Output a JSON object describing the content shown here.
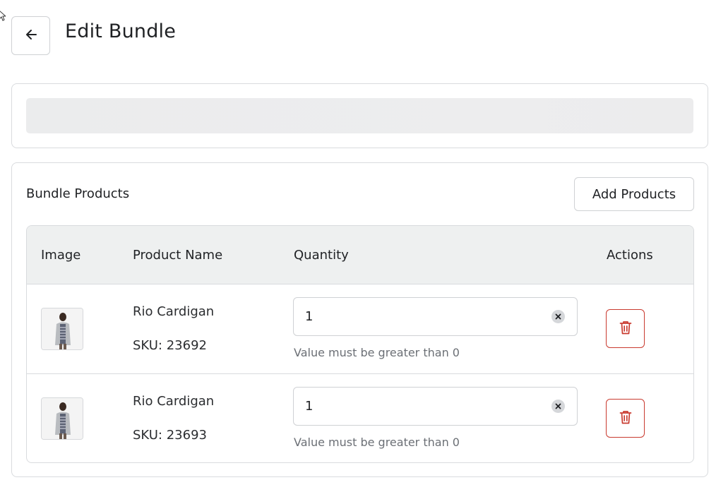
{
  "header": {
    "back_icon": "arrow-left-icon",
    "title": "Edit Bundle"
  },
  "bundle_products": {
    "title": "Bundle Products",
    "add_button_label": "Add Products",
    "columns": [
      "Image",
      "Product Name",
      "Quantity",
      "Actions"
    ],
    "rows": [
      {
        "image_icon": "product-thumbnail",
        "name": "Rio Cardigan",
        "sku": "SKU: 23692",
        "quantity": "1",
        "helper_text": "Value must be greater than 0",
        "clear_icon": "clear-x-icon",
        "delete_icon": "trash-icon"
      },
      {
        "image_icon": "product-thumbnail",
        "name": "Rio Cardigan",
        "sku": "SKU: 23693",
        "quantity": "1",
        "helper_text": "Value must be greater than 0",
        "clear_icon": "clear-x-icon",
        "delete_icon": "trash-icon"
      }
    ]
  },
  "colors": {
    "delete_accent": "#c93a2f",
    "table_header_bg": "#eef0f0",
    "border": "#d9dbde"
  }
}
